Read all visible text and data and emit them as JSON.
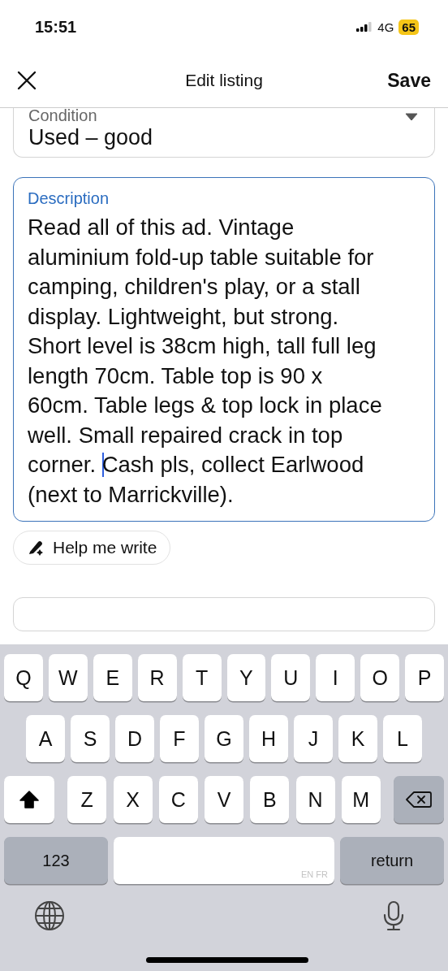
{
  "status_bar": {
    "time": "15:51",
    "network": "4G",
    "battery": "65"
  },
  "header": {
    "title": "Edit listing",
    "action": "Save"
  },
  "condition": {
    "label": "Condition",
    "value": "Used – good"
  },
  "description": {
    "label": "Description",
    "focused": true,
    "value_before_cursor": "Read all of this ad. Vintage aluminium fold-up table suitable for camping, children's play, or a stall display. Lightweight, but strong. Short level is 38cm high, tall full leg length 70cm. Table top is 90 x 60cm. Table legs & top lock in place well. Small repaired crack in top corner. ",
    "value_after_cursor": "Cash pls, collect Earlwood (next to Marrickville)."
  },
  "help_button": {
    "label": "Help me write"
  },
  "keyboard": {
    "rows": [
      {
        "keys": [
          {
            "kind": "letter",
            "label": "Q"
          },
          {
            "kind": "letter",
            "label": "W"
          },
          {
            "kind": "letter",
            "label": "E"
          },
          {
            "kind": "letter",
            "label": "R"
          },
          {
            "kind": "letter",
            "label": "T"
          },
          {
            "kind": "letter",
            "label": "Y"
          },
          {
            "kind": "letter",
            "label": "U"
          },
          {
            "kind": "letter",
            "label": "I"
          },
          {
            "kind": "letter",
            "label": "O"
          },
          {
            "kind": "letter",
            "label": "P"
          }
        ]
      },
      {
        "keys": [
          {
            "kind": "letter",
            "label": "A"
          },
          {
            "kind": "letter",
            "label": "S"
          },
          {
            "kind": "letter",
            "label": "D"
          },
          {
            "kind": "letter",
            "label": "F"
          },
          {
            "kind": "letter",
            "label": "G"
          },
          {
            "kind": "letter",
            "label": "H"
          },
          {
            "kind": "letter",
            "label": "J"
          },
          {
            "kind": "letter",
            "label": "K"
          },
          {
            "kind": "letter",
            "label": "L"
          }
        ]
      },
      {
        "keys": [
          {
            "kind": "shift",
            "on": true
          },
          {
            "kind": "letter",
            "label": "Z"
          },
          {
            "kind": "letter",
            "label": "X"
          },
          {
            "kind": "letter",
            "label": "C"
          },
          {
            "kind": "letter",
            "label": "V"
          },
          {
            "kind": "letter",
            "label": "B"
          },
          {
            "kind": "letter",
            "label": "N"
          },
          {
            "kind": "letter",
            "label": "M"
          },
          {
            "kind": "backspace"
          }
        ]
      },
      {
        "keys": [
          {
            "kind": "numbers",
            "label": "123"
          },
          {
            "kind": "space",
            "label": "EN FR"
          },
          {
            "kind": "return",
            "label": "return"
          }
        ]
      }
    ]
  }
}
